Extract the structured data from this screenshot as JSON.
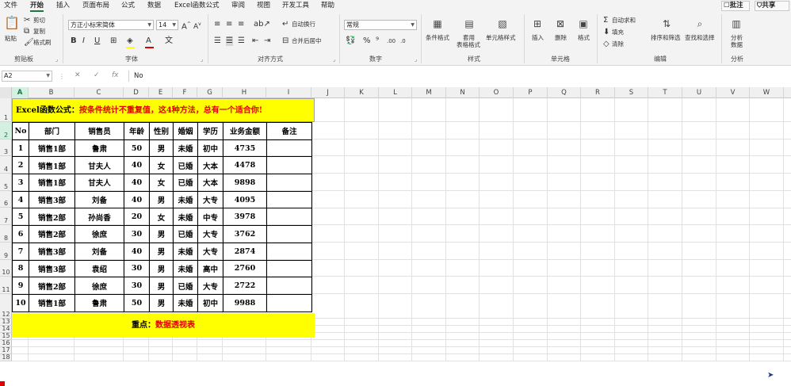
{
  "menu": {
    "tabs": [
      "文件",
      "开始",
      "插入",
      "页面布局",
      "公式",
      "数据",
      "Excel函数公式",
      "审阅",
      "视图",
      "开发工具",
      "帮助"
    ],
    "active_tab": "开始",
    "comment_label": "批注",
    "share_label": "共享"
  },
  "ribbon": {
    "clipboard": {
      "paste_label": "粘贴",
      "cut_label": "剪切",
      "copy_label": "复制",
      "format_painter_label": "格式刷",
      "group_label": "剪贴板"
    },
    "font": {
      "font_name": "方正小标宋简体",
      "font_size": "14",
      "group_label": "字体"
    },
    "alignment": {
      "wrap_label": "自动换行",
      "merge_label": "合并后居中",
      "group_label": "对齐方式"
    },
    "number": {
      "format_value": "常规",
      "group_label": "数字"
    },
    "styles": {
      "conditional_label": "条件格式",
      "table_label1": "套用",
      "table_label2": "表格格式",
      "cell_style_label": "单元格样式",
      "group_label": "样式"
    },
    "cells": {
      "insert_label": "插入",
      "delete_label": "删除",
      "format_label": "格式",
      "group_label": "单元格"
    },
    "editing": {
      "autosum_label": "自动求和",
      "fill_label": "填充",
      "clear_label": "清除",
      "sort_label": "排序和筛选",
      "find_label": "查找和选择",
      "group_label": "编辑"
    },
    "analysis": {
      "analyze_label1": "分析",
      "analyze_label2": "数据",
      "group_label": "分析"
    }
  },
  "formula_bar": {
    "name_box": "A2",
    "fx": "fx",
    "value": "No"
  },
  "sheet": {
    "columns": [
      "A",
      "B",
      "C",
      "D",
      "E",
      "F",
      "G",
      "H",
      "I",
      "J",
      "K",
      "L",
      "M",
      "N",
      "O",
      "P",
      "Q",
      "R",
      "S",
      "T",
      "U",
      "V",
      "W"
    ],
    "selected_column": "A",
    "rows": [
      "1",
      "2",
      "3",
      "4",
      "5",
      "6",
      "7",
      "8",
      "9",
      "10",
      "11",
      "12",
      "13",
      "14",
      "15",
      "16",
      "17",
      "18"
    ],
    "selected_row": "2",
    "title_black": "Excel函数公式：",
    "title_red": "按条件统计不重复值，这4种方法，总有一个适合你!",
    "headers": [
      "No",
      "部门",
      "销售员",
      "年龄",
      "性别",
      "婚姻",
      "学历",
      "业务金额",
      "备注"
    ],
    "data": [
      [
        "1",
        "销售1部",
        "鲁肃",
        "50",
        "男",
        "未婚",
        "初中",
        "4735",
        ""
      ],
      [
        "2",
        "销售1部",
        "甘夫人",
        "40",
        "女",
        "已婚",
        "大本",
        "4478",
        ""
      ],
      [
        "3",
        "销售1部",
        "甘夫人",
        "40",
        "女",
        "已婚",
        "大本",
        "9898",
        ""
      ],
      [
        "4",
        "销售3部",
        "刘备",
        "40",
        "男",
        "未婚",
        "大专",
        "4095",
        ""
      ],
      [
        "5",
        "销售2部",
        "孙尚香",
        "20",
        "女",
        "未婚",
        "中专",
        "3978",
        ""
      ],
      [
        "6",
        "销售2部",
        "徐庶",
        "30",
        "男",
        "已婚",
        "大专",
        "3762",
        ""
      ],
      [
        "7",
        "销售3部",
        "刘备",
        "40",
        "男",
        "未婚",
        "大专",
        "2874",
        ""
      ],
      [
        "8",
        "销售3部",
        "袁绍",
        "30",
        "男",
        "未婚",
        "高中",
        "2760",
        ""
      ],
      [
        "9",
        "销售2部",
        "徐庶",
        "30",
        "男",
        "已婚",
        "大专",
        "2722",
        ""
      ],
      [
        "10",
        "销售1部",
        "鲁肃",
        "50",
        "男",
        "未婚",
        "初中",
        "9988",
        ""
      ]
    ],
    "footer_black": "重点：",
    "footer_red": "数据透视表"
  }
}
